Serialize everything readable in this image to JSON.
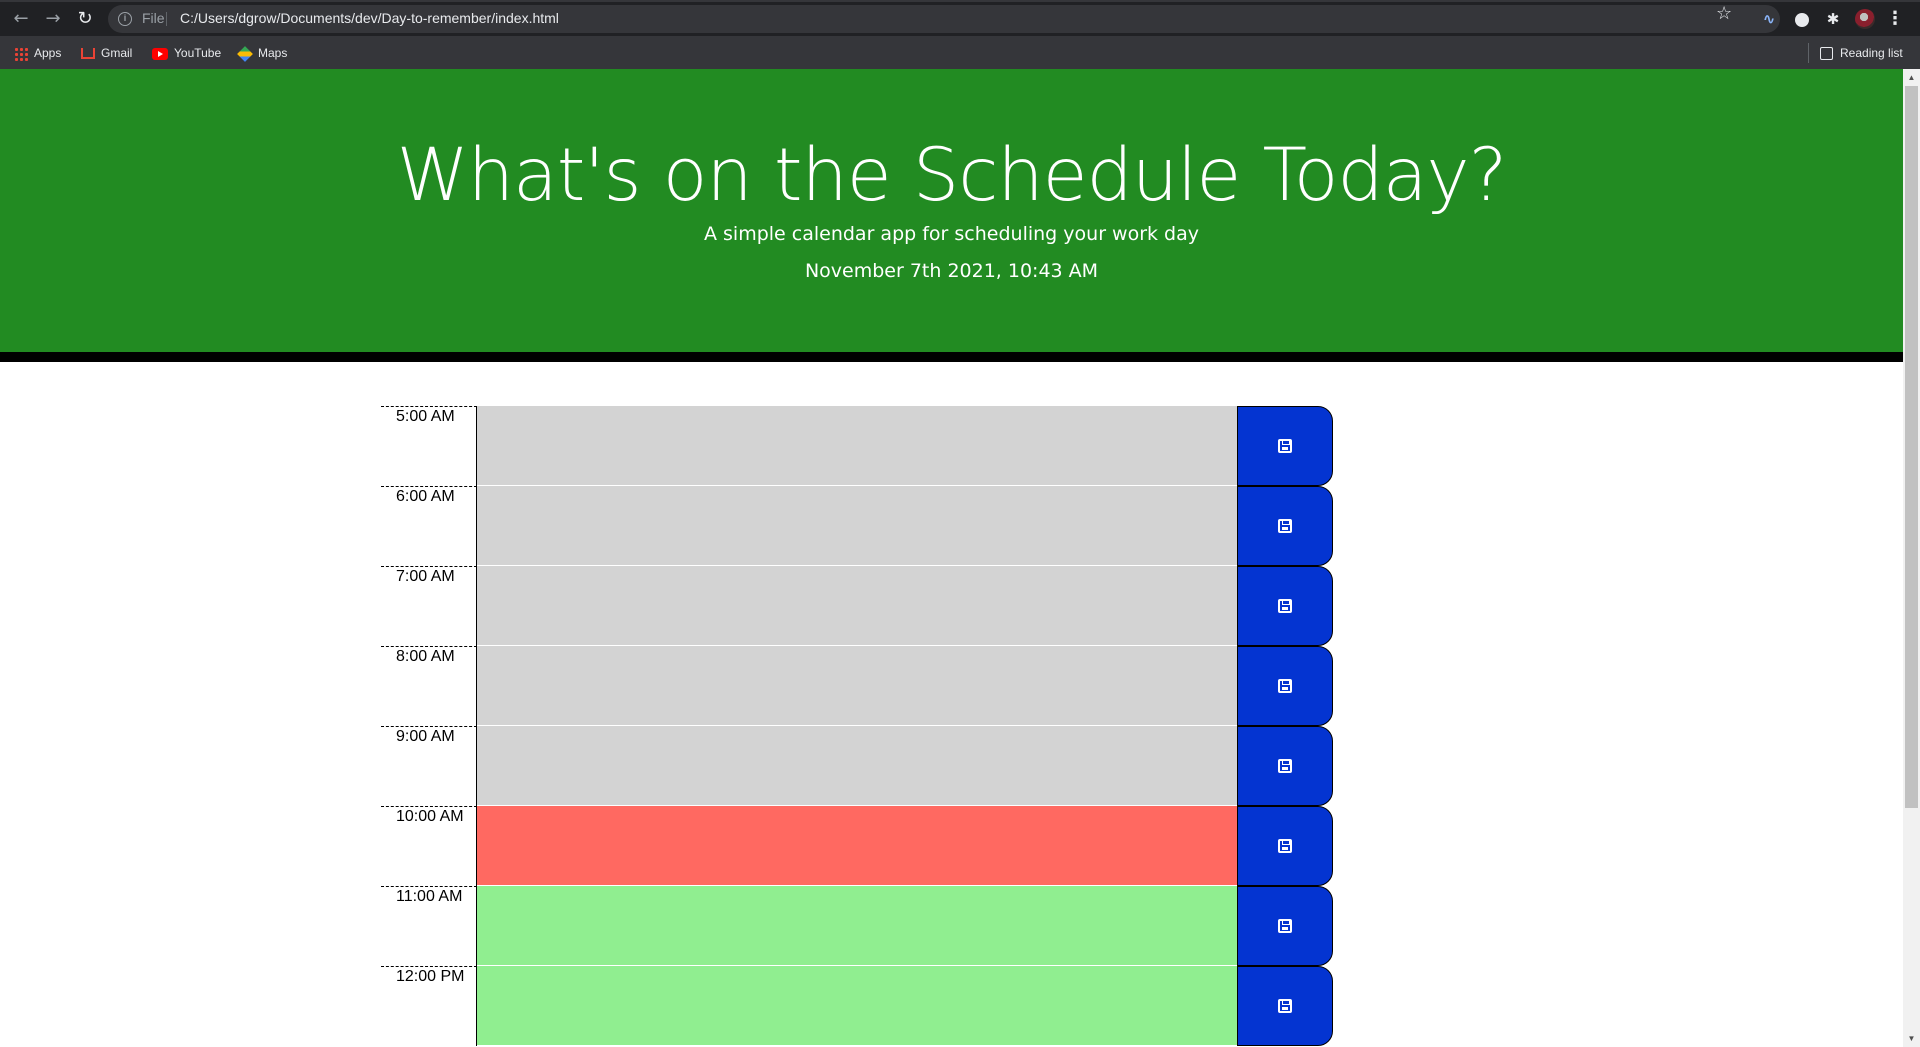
{
  "browser": {
    "scheme_label": "File",
    "url": "C:/Users/dgrow/Documents/dev/Day-to-remember/index.html",
    "bookmarks": [
      {
        "label": "Apps"
      },
      {
        "label": "Gmail"
      },
      {
        "label": "YouTube"
      },
      {
        "label": "Maps"
      }
    ],
    "reading_list_label": "Reading list"
  },
  "header": {
    "title": "What's on the Schedule Today?",
    "subtitle": "A simple calendar app for scheduling your work day",
    "current_day": "November 7th 2021, 10:43 AM"
  },
  "colors": {
    "header_bg": "#228b22",
    "past": "#d3d3d3",
    "present": "#ff6961",
    "future": "#90ee90",
    "save_button": "#0434d1"
  },
  "schedule": {
    "rows": [
      {
        "hour": "5:00 AM",
        "status": "past",
        "text": ""
      },
      {
        "hour": "6:00 AM",
        "status": "past",
        "text": ""
      },
      {
        "hour": "7:00 AM",
        "status": "past",
        "text": ""
      },
      {
        "hour": "8:00 AM",
        "status": "past",
        "text": ""
      },
      {
        "hour": "9:00 AM",
        "status": "past",
        "text": ""
      },
      {
        "hour": "10:00 AM",
        "status": "present",
        "text": ""
      },
      {
        "hour": "11:00 AM",
        "status": "future",
        "text": ""
      },
      {
        "hour": "12:00 PM",
        "status": "future",
        "text": ""
      }
    ],
    "save_icon": "floppy-disk-icon"
  }
}
